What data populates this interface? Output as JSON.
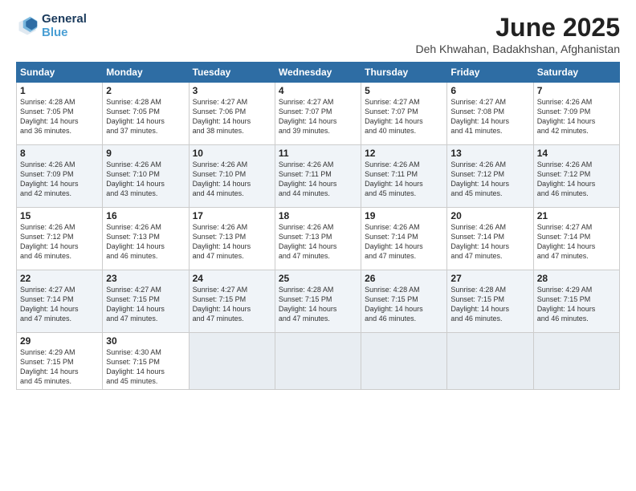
{
  "header": {
    "logo_line1": "General",
    "logo_line2": "Blue",
    "title": "June 2025",
    "subtitle": "Deh Khwahan, Badakhshan, Afghanistan"
  },
  "weekdays": [
    "Sunday",
    "Monday",
    "Tuesday",
    "Wednesday",
    "Thursday",
    "Friday",
    "Saturday"
  ],
  "weeks": [
    [
      {
        "day": "1",
        "text": "Sunrise: 4:28 AM\nSunset: 7:05 PM\nDaylight: 14 hours\nand 36 minutes."
      },
      {
        "day": "2",
        "text": "Sunrise: 4:28 AM\nSunset: 7:05 PM\nDaylight: 14 hours\nand 37 minutes."
      },
      {
        "day": "3",
        "text": "Sunrise: 4:27 AM\nSunset: 7:06 PM\nDaylight: 14 hours\nand 38 minutes."
      },
      {
        "day": "4",
        "text": "Sunrise: 4:27 AM\nSunset: 7:07 PM\nDaylight: 14 hours\nand 39 minutes."
      },
      {
        "day": "5",
        "text": "Sunrise: 4:27 AM\nSunset: 7:07 PM\nDaylight: 14 hours\nand 40 minutes."
      },
      {
        "day": "6",
        "text": "Sunrise: 4:27 AM\nSunset: 7:08 PM\nDaylight: 14 hours\nand 41 minutes."
      },
      {
        "day": "7",
        "text": "Sunrise: 4:26 AM\nSunset: 7:09 PM\nDaylight: 14 hours\nand 42 minutes."
      }
    ],
    [
      {
        "day": "8",
        "text": "Sunrise: 4:26 AM\nSunset: 7:09 PM\nDaylight: 14 hours\nand 42 minutes."
      },
      {
        "day": "9",
        "text": "Sunrise: 4:26 AM\nSunset: 7:10 PM\nDaylight: 14 hours\nand 43 minutes."
      },
      {
        "day": "10",
        "text": "Sunrise: 4:26 AM\nSunset: 7:10 PM\nDaylight: 14 hours\nand 44 minutes."
      },
      {
        "day": "11",
        "text": "Sunrise: 4:26 AM\nSunset: 7:11 PM\nDaylight: 14 hours\nand 44 minutes."
      },
      {
        "day": "12",
        "text": "Sunrise: 4:26 AM\nSunset: 7:11 PM\nDaylight: 14 hours\nand 45 minutes."
      },
      {
        "day": "13",
        "text": "Sunrise: 4:26 AM\nSunset: 7:12 PM\nDaylight: 14 hours\nand 45 minutes."
      },
      {
        "day": "14",
        "text": "Sunrise: 4:26 AM\nSunset: 7:12 PM\nDaylight: 14 hours\nand 46 minutes."
      }
    ],
    [
      {
        "day": "15",
        "text": "Sunrise: 4:26 AM\nSunset: 7:12 PM\nDaylight: 14 hours\nand 46 minutes."
      },
      {
        "day": "16",
        "text": "Sunrise: 4:26 AM\nSunset: 7:13 PM\nDaylight: 14 hours\nand 46 minutes."
      },
      {
        "day": "17",
        "text": "Sunrise: 4:26 AM\nSunset: 7:13 PM\nDaylight: 14 hours\nand 47 minutes."
      },
      {
        "day": "18",
        "text": "Sunrise: 4:26 AM\nSunset: 7:13 PM\nDaylight: 14 hours\nand 47 minutes."
      },
      {
        "day": "19",
        "text": "Sunrise: 4:26 AM\nSunset: 7:14 PM\nDaylight: 14 hours\nand 47 minutes."
      },
      {
        "day": "20",
        "text": "Sunrise: 4:26 AM\nSunset: 7:14 PM\nDaylight: 14 hours\nand 47 minutes."
      },
      {
        "day": "21",
        "text": "Sunrise: 4:27 AM\nSunset: 7:14 PM\nDaylight: 14 hours\nand 47 minutes."
      }
    ],
    [
      {
        "day": "22",
        "text": "Sunrise: 4:27 AM\nSunset: 7:14 PM\nDaylight: 14 hours\nand 47 minutes."
      },
      {
        "day": "23",
        "text": "Sunrise: 4:27 AM\nSunset: 7:15 PM\nDaylight: 14 hours\nand 47 minutes."
      },
      {
        "day": "24",
        "text": "Sunrise: 4:27 AM\nSunset: 7:15 PM\nDaylight: 14 hours\nand 47 minutes."
      },
      {
        "day": "25",
        "text": "Sunrise: 4:28 AM\nSunset: 7:15 PM\nDaylight: 14 hours\nand 47 minutes."
      },
      {
        "day": "26",
        "text": "Sunrise: 4:28 AM\nSunset: 7:15 PM\nDaylight: 14 hours\nand 46 minutes."
      },
      {
        "day": "27",
        "text": "Sunrise: 4:28 AM\nSunset: 7:15 PM\nDaylight: 14 hours\nand 46 minutes."
      },
      {
        "day": "28",
        "text": "Sunrise: 4:29 AM\nSunset: 7:15 PM\nDaylight: 14 hours\nand 46 minutes."
      }
    ],
    [
      {
        "day": "29",
        "text": "Sunrise: 4:29 AM\nSunset: 7:15 PM\nDaylight: 14 hours\nand 45 minutes."
      },
      {
        "day": "30",
        "text": "Sunrise: 4:30 AM\nSunset: 7:15 PM\nDaylight: 14 hours\nand 45 minutes."
      },
      {
        "day": "",
        "text": ""
      },
      {
        "day": "",
        "text": ""
      },
      {
        "day": "",
        "text": ""
      },
      {
        "day": "",
        "text": ""
      },
      {
        "day": "",
        "text": ""
      }
    ]
  ]
}
